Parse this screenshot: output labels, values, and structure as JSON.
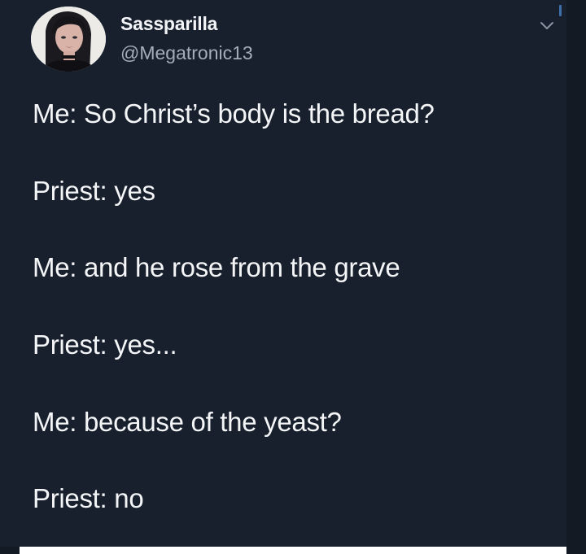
{
  "tweet": {
    "display_name": "Sassparilla",
    "handle": "@Megatronic13",
    "lines": [
      "Me: So Christ’s body is the bread?",
      "Priest: yes",
      "Me: and he rose from the grave",
      "Priest: yes...",
      "Me: because of the yeast?",
      "Priest: no"
    ]
  },
  "icons": {
    "menu": "chevron-down-icon",
    "avatar": "profile-photo"
  },
  "colors": {
    "background": "#18202e",
    "text": "#f4f5f7",
    "handle": "#a3adba"
  }
}
